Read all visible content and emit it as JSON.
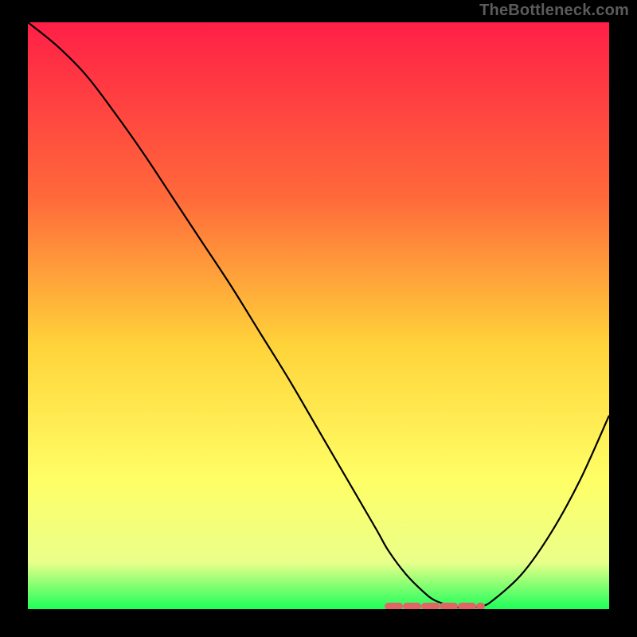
{
  "watermark": "TheBottleneck.com",
  "colors": {
    "bg": "#000000",
    "watermark_text": "#5b5b5b",
    "gradient_top": "#ff1f47",
    "gradient_mid1": "#ff6a3a",
    "gradient_mid2": "#ffd33a",
    "gradient_mid3": "#ffff66",
    "gradient_mid4": "#eaff8a",
    "gradient_bottom": "#1dff5a",
    "curve": "#000000",
    "highlight": "#e06666"
  },
  "chart_data": {
    "type": "line",
    "title": "",
    "xlabel": "",
    "ylabel": "",
    "xlim": [
      0,
      100
    ],
    "ylim": [
      0,
      100
    ],
    "series": [
      {
        "name": "bottleneck-curve",
        "x": [
          0,
          5,
          10,
          15,
          20,
          25,
          30,
          35,
          40,
          45,
          50,
          55,
          60,
          62,
          65,
          68,
          70,
          73,
          75,
          78,
          80,
          85,
          90,
          95,
          100
        ],
        "y": [
          100,
          96,
          91,
          84.5,
          77.5,
          70,
          62.5,
          55,
          47,
          39,
          30.5,
          22,
          13.5,
          10,
          6,
          3,
          1.5,
          0.5,
          0.2,
          0.5,
          1.5,
          6,
          13,
          22,
          33
        ]
      }
    ],
    "highlight_range_x": [
      62,
      78
    ],
    "highlight_y": 0.5,
    "annotations": []
  }
}
